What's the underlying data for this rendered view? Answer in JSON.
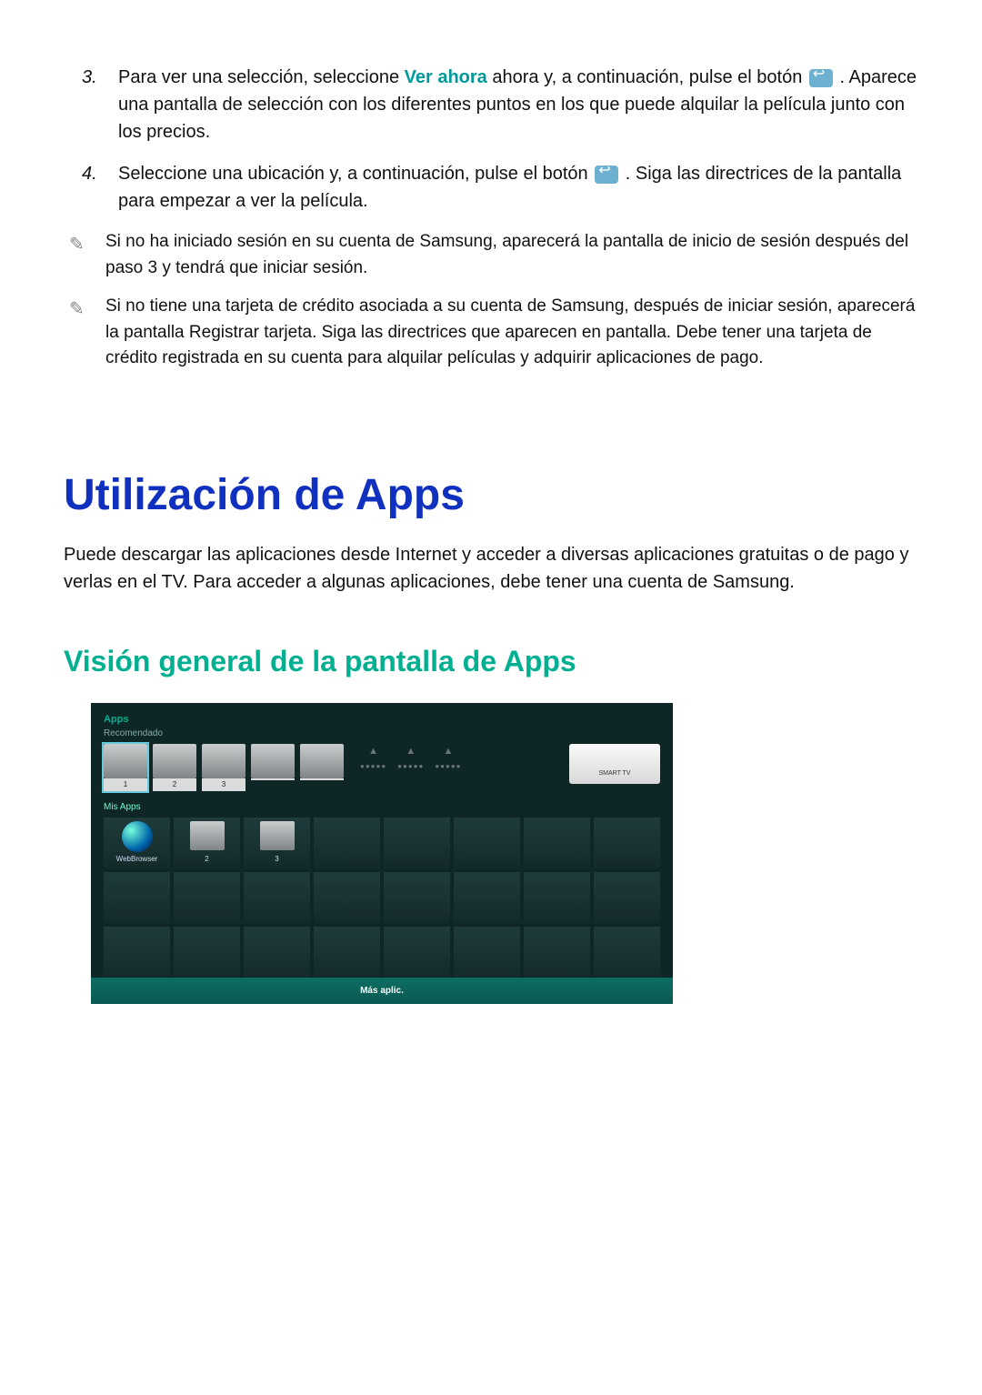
{
  "steps": {
    "s3": {
      "num": "3.",
      "pre": "Para ver una selección, seleccione ",
      "highlight": "Ver ahora",
      "post": " ahora y, a continuación, pulse el botón ",
      "tail": ". Aparece una pantalla de selección con los diferentes puntos en los que puede alquilar la película junto con los precios."
    },
    "s4": {
      "num": "4.",
      "pre": "Seleccione una ubicación y, a continuación, pulse el botón ",
      "post": ". Siga las directrices de la pantalla para empezar a ver la película."
    }
  },
  "notes": {
    "n1": "Si no ha iniciado sesión en su cuenta de Samsung, aparecerá la pantalla de inicio de sesión después del paso 3 y tendrá que iniciar sesión.",
    "n2": "Si no tiene una tarjeta de crédito asociada a su cuenta de Samsung, después de iniciar sesión, aparecerá la pantalla Registrar tarjeta. Siga las directrices que aparecen en pantalla. Debe tener una tarjeta de crédito registrada en su cuenta para alquilar películas y adquirir aplicaciones de pago."
  },
  "headings": {
    "h1": "Utilización de Apps",
    "intro": "Puede descargar las aplicaciones desde Internet y acceder a diversas aplicaciones gratuitas o de pago y verlas en el TV. Para acceder a algunas aplicaciones, debe tener una cuenta de Samsung.",
    "h2": "Visión general de la pantalla de Apps"
  },
  "tv": {
    "apps": "Apps",
    "recomendado": "Recomendado",
    "rec_labels": [
      "1",
      "2",
      "3",
      "",
      ""
    ],
    "smart": "SMART TV",
    "myapps": "Mis Apps",
    "web": "WebBrowser",
    "g2": "2",
    "g3": "3",
    "more": "Más aplic."
  }
}
